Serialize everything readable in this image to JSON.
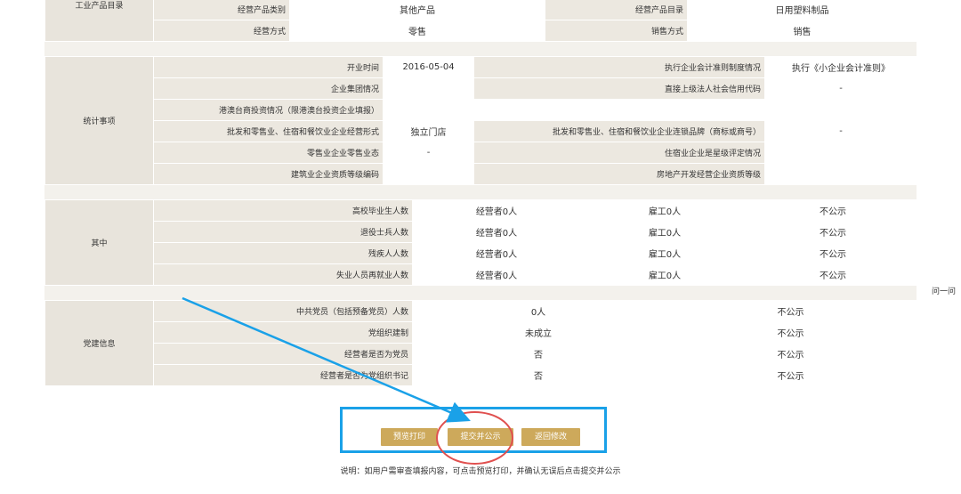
{
  "business": {
    "section_label": "工业产品目录",
    "rows": [
      {
        "l1": "经营产品类别",
        "v1": "其他产品",
        "l2": "经营产品目录",
        "v2": "日用塑料制品"
      },
      {
        "l1": "经营方式",
        "v1": "零售",
        "l2": "销售方式",
        "v2": "销售"
      }
    ]
  },
  "stats": {
    "section_label": "统计事项",
    "rows": [
      {
        "l1": "开业时间",
        "v1": "2016-05-04",
        "l2": "执行企业会计准则制度情况",
        "v2": "执行《小企业会计准则》"
      },
      {
        "l1": "企业集团情况",
        "v1": "",
        "l2": "直接上级法人社会信用代码",
        "v2": "-"
      },
      {
        "l1": "港澳台商投资情况（限港澳台投资企业填报）",
        "v1": "",
        "l2": "",
        "v2": ""
      },
      {
        "l1": "批发和零售业、住宿和餐饮业企业经营形式",
        "v1": "独立门店",
        "l2": "批发和零售业、住宿和餐饮业企业连锁品牌（商标或商号）",
        "v2": "-"
      },
      {
        "l1": "零售业企业零售业态",
        "v1": "-",
        "l2": "住宿业企业是星级评定情况",
        "v2": ""
      },
      {
        "l1": "建筑业企业资质等级编码",
        "v1": "",
        "l2": "房地产开发经营企业资质等级",
        "v2": ""
      }
    ]
  },
  "among": {
    "section_label": "其中",
    "rows": [
      {
        "label": "高校毕业生人数",
        "c1": "经营者0人",
        "c2": "雇工0人",
        "c3": "不公示"
      },
      {
        "label": "退役士兵人数",
        "c1": "经营者0人",
        "c2": "雇工0人",
        "c3": "不公示"
      },
      {
        "label": "残疾人人数",
        "c1": "经营者0人",
        "c2": "雇工0人",
        "c3": "不公示"
      },
      {
        "label": "失业人员再就业人数",
        "c1": "经营者0人",
        "c2": "雇工0人",
        "c3": "不公示"
      }
    ]
  },
  "party": {
    "section_label": "党建信息",
    "rows": [
      {
        "label": "中共党员（包括预备党员）人数",
        "v": "0人",
        "p": "不公示"
      },
      {
        "label": "党组织建制",
        "v": "未成立",
        "p": "不公示"
      },
      {
        "label": "经营者是否为党员",
        "v": "否",
        "p": "不公示"
      },
      {
        "label": "经营者是否为党组织书记",
        "v": "否",
        "p": "不公示"
      }
    ]
  },
  "actions": {
    "preview_print": "预览打印",
    "submit_publish": "提交并公示",
    "return_edit": "返回修改"
  },
  "note": "说明：如用户需审查填报内容，可点击预览打印，并确认无误后点击提交并公示",
  "side_text": "问一问",
  "colors": {
    "button": "#cda95b",
    "highlight_frame": "#1aa1e8",
    "circle": "#e0504f",
    "label_bg": "#ece8e0"
  }
}
